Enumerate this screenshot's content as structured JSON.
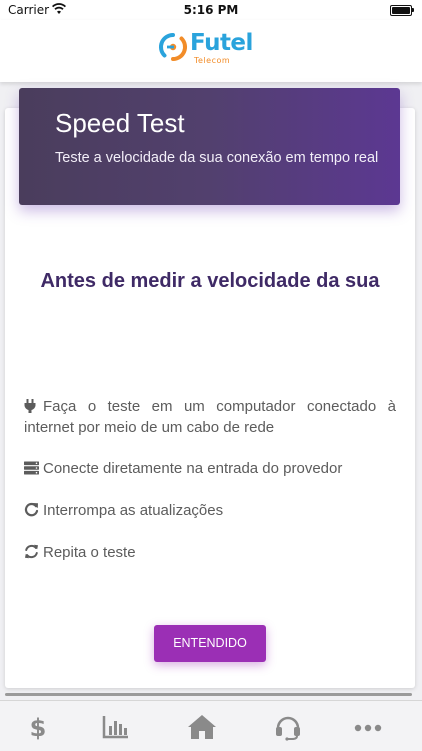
{
  "status_bar": {
    "carrier": "Carrier",
    "time": "5:16 PM"
  },
  "header": {
    "brand": "Futel",
    "brand_sub": "Telecom"
  },
  "hero": {
    "title": "Speed Test",
    "subtitle": "Teste a velocidade da sua conexão em tempo real"
  },
  "main": {
    "heading": "Antes de medir a velocidade da sua",
    "tips": [
      {
        "icon": "plug-icon",
        "text": "Faça o teste em um computador conectado à internet por meio de um cabo de rede"
      },
      {
        "icon": "server-icon",
        "text": "Conecte diretamente na entrada do provedor"
      },
      {
        "icon": "redo-icon",
        "text": "Interrompa as atualizações"
      },
      {
        "icon": "sync-icon",
        "text": "Repita o teste"
      }
    ],
    "button_label": "ENTENDIDO"
  },
  "tab_bar": {
    "items": [
      "dollar-icon",
      "chart-icon",
      "home-icon",
      "headset-icon",
      "more-icon"
    ]
  },
  "colors": {
    "brand_blue": "#2aa3dc",
    "brand_orange": "#f28c28",
    "hero_gradient_start": "#4a3d5c",
    "hero_gradient_end": "#5c3892",
    "heading": "#3f2a66",
    "button": "#9b2fb5",
    "tab_icon": "#8a8a8a"
  }
}
